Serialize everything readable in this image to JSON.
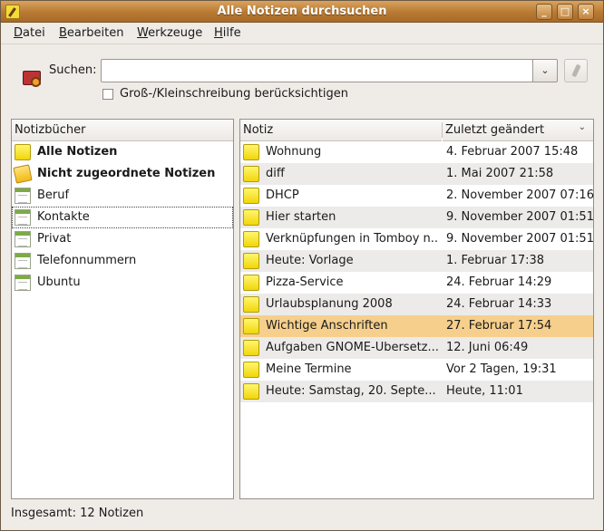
{
  "window": {
    "title": "Alle Notizen durchsuchen",
    "minimize": "_",
    "maximize": "□",
    "close": "×"
  },
  "menu": [
    {
      "first": "D",
      "rest": "atei"
    },
    {
      "first": "B",
      "rest": "earbeiten"
    },
    {
      "first": "W",
      "rest": "erkzeuge"
    },
    {
      "first": "H",
      "rest": "ilfe"
    }
  ],
  "search": {
    "label": "Suchen:",
    "value": "",
    "dropdown_icon": "chevron-down-icon",
    "dropdown_glyph": "⌄",
    "case_label": "Groß-/Kleinschreibung berücksichtigen",
    "case_checked": false
  },
  "notebooks": {
    "header": "Notizbücher",
    "items": [
      {
        "label": "Alle Notizen",
        "icon": "note-icon",
        "bold": true
      },
      {
        "label": "Nicht zugeordnete Notizen",
        "icon": "unfiled-notes-icon",
        "bold": true
      },
      {
        "label": "Beruf",
        "icon": "notebook-icon"
      },
      {
        "label": "Kontakte",
        "icon": "notebook-icon"
      },
      {
        "label": "Privat",
        "icon": "notebook-icon"
      },
      {
        "label": "Telefonnummern",
        "icon": "notebook-icon"
      },
      {
        "label": "Ubuntu",
        "icon": "notebook-icon"
      }
    ]
  },
  "notes": {
    "col_title": "Notiz",
    "col_date": "Zuletzt geändert",
    "sort_glyph": "⌄",
    "rows": [
      {
        "title": "Wohnung",
        "date": "4. Februar 2007 15:48"
      },
      {
        "title": "diff",
        "date": "1. Mai 2007 21:58"
      },
      {
        "title": "DHCP",
        "date": "2. November 2007 07:16"
      },
      {
        "title": "Hier starten",
        "date": "9. November 2007 01:51"
      },
      {
        "title": "Verknüpfungen in Tomboy n...",
        "date": "9. November 2007 01:51"
      },
      {
        "title": "Heute: Vorlage",
        "date": "1. Februar 17:38"
      },
      {
        "title": "Pizza-Service",
        "date": "24. Februar 14:29"
      },
      {
        "title": "Urlaubsplanung 2008",
        "date": "24. Februar 14:33"
      },
      {
        "title": "Wichtige Anschriften",
        "date": "27. Februar 17:54"
      },
      {
        "title": "Aufgaben GNOME-Übersetz...",
        "date": "12. Juni 06:49"
      },
      {
        "title": "Meine Termine",
        "date": "Vor 2 Tagen, 19:31"
      },
      {
        "title": "Heute: Samstag, 20. Septe...",
        "date": "Heute, 11:01"
      }
    ]
  },
  "status": "Insgesamt: 12 Notizen",
  "colors": {
    "titlebar": "#b87a33",
    "selection": "#f6cf8c",
    "alt_row": "#edebe9"
  }
}
